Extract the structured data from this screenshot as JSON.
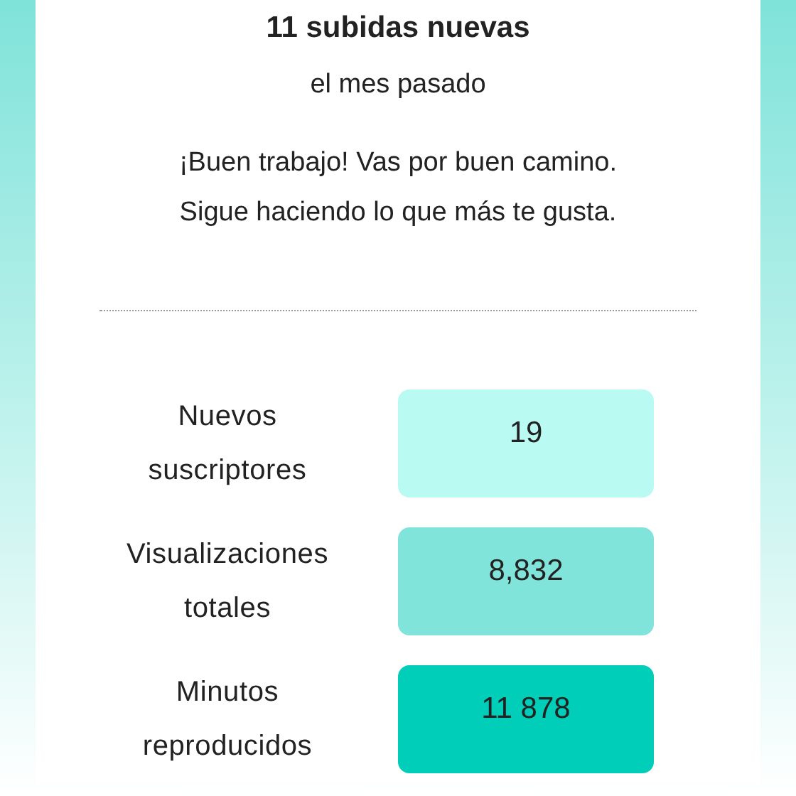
{
  "summary": {
    "title": "11 subidas nuevas",
    "period": "el mes pasado",
    "message": "¡Buen trabajo! Vas por buen camino. Sigue haciendo lo que más te gusta."
  },
  "stats": [
    {
      "label": "Nuevos suscriptores",
      "value": "19",
      "color": "#b9fbf3"
    },
    {
      "label": "Visualizaciones totales",
      "value": "8,832",
      "color": "#80e4db"
    },
    {
      "label": "Minutos reproducidos",
      "value": "11 878",
      "color": "#00ceb8"
    }
  ]
}
